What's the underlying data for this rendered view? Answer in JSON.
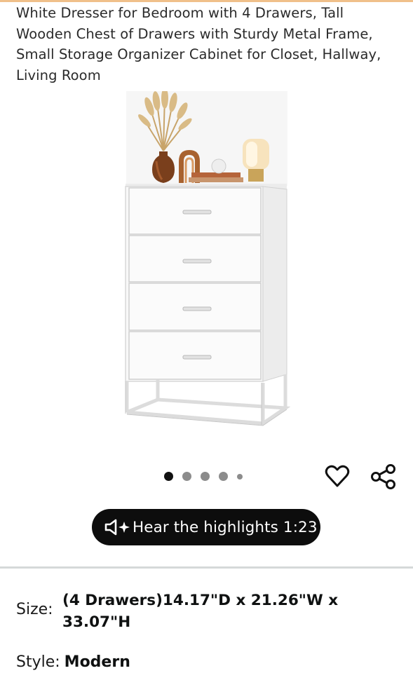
{
  "product": {
    "title": "White Dresser for Bedroom with 4 Drawers, Tall Wooden Chest of Drawers with Sturdy Metal Frame, Small Storage Organizer Cabinet for Closet, Hallway, Living Room",
    "image_count": 5,
    "active_image": 1
  },
  "audio": {
    "label": "Hear the highlights 1:23",
    "icon": "speaker-sparkle-icon"
  },
  "actions": {
    "favorite_icon": "heart-icon",
    "share_icon": "share-icon"
  },
  "variations": {
    "size_label": "Size:",
    "size_value": "(4 Drawers)14.17\"D x 21.26\"W x 33.07\"H",
    "style_label": "Style:",
    "style_value": "Modern"
  },
  "colors": {
    "accent_strip": "#f0c08a",
    "pill_background": "#0d0d0d",
    "divider": "#d5d9d9"
  }
}
